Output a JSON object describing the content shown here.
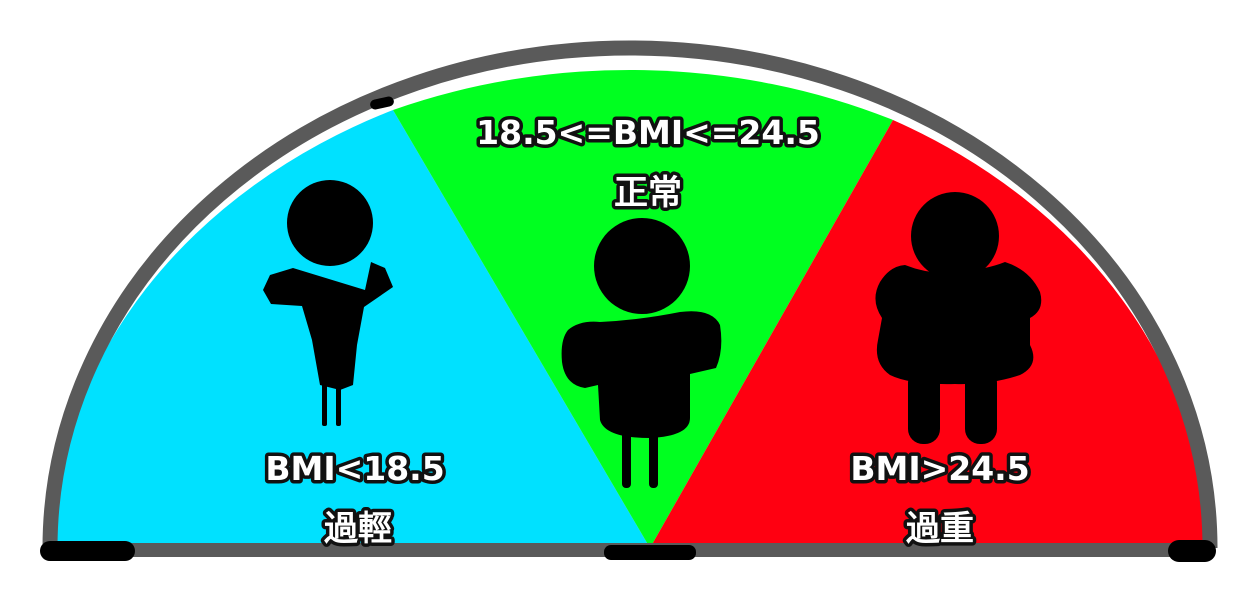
{
  "zones": [
    {
      "range": "BMI<18.5",
      "status": "過輕",
      "color": "#00e1ff"
    },
    {
      "range": "18.5<=BMI<=24.5",
      "status": "正常",
      "color": "#00ff20"
    },
    {
      "range": "BMI>24.5",
      "status": "過重",
      "color": "#ff0011"
    }
  ],
  "colors": {
    "rim": "#5a5a5a",
    "figure": "#000000"
  },
  "icons": [
    "underweight-figure-icon",
    "normal-weight-figure-icon",
    "overweight-figure-icon"
  ]
}
